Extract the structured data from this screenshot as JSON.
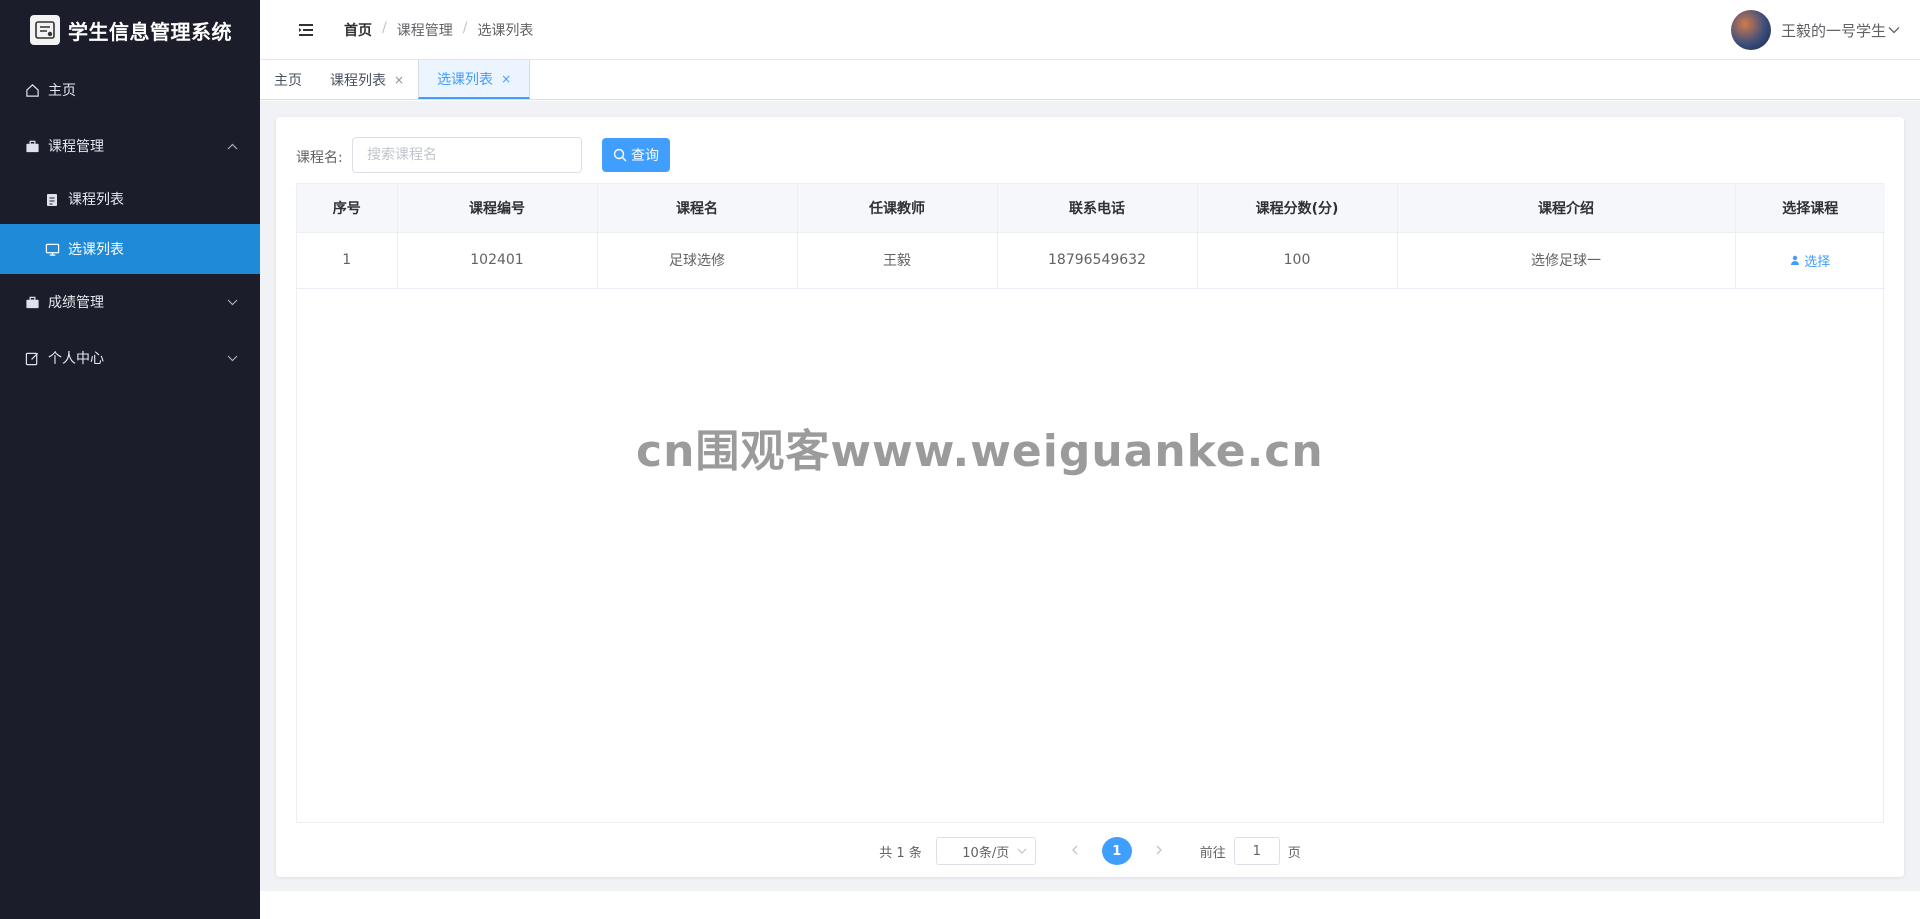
{
  "app": {
    "title": "学生信息管理系统"
  },
  "sidebar": {
    "items": [
      {
        "label": "主页"
      },
      {
        "label": "课程管理"
      },
      {
        "label": "成绩管理"
      },
      {
        "label": "个人中心"
      }
    ],
    "sub_items": [
      {
        "label": "课程列表"
      },
      {
        "label": "选课列表"
      }
    ],
    "active_color": "#1f8ad8"
  },
  "header": {
    "breadcrumb": [
      "首页",
      "课程管理",
      "选课列表"
    ],
    "separator": "/",
    "user_name": "王毅的一号学生"
  },
  "tabs": [
    {
      "label": "主页"
    },
    {
      "label": "课程列表",
      "close": "×"
    },
    {
      "label": "选课列表",
      "close": "×"
    }
  ],
  "search": {
    "label": "课程名:",
    "placeholder": "搜索课程名",
    "button_label": "查询"
  },
  "table": {
    "columns": [
      "序号",
      "课程编号",
      "课程名",
      "任课教师",
      "联系电话",
      "课程分数(分)",
      "课程介绍",
      "选择课程"
    ],
    "rows": [
      {
        "index": "1",
        "course_id": "102401",
        "course_name": "足球选修",
        "teacher": "王毅",
        "phone": "18796549632",
        "score": "100",
        "intro": "选修足球一",
        "action": "选择"
      }
    ]
  },
  "watermark": "cn围观客www.weiguanke.cn",
  "pagination": {
    "total_text": "共 1 条",
    "page_size": "10条/页",
    "current_page": "1",
    "goto_label": "前往",
    "goto_value": "1",
    "page_word": "页"
  },
  "colors": {
    "primary": "#409eff",
    "sidebar_bg": "#1b1d2a"
  }
}
